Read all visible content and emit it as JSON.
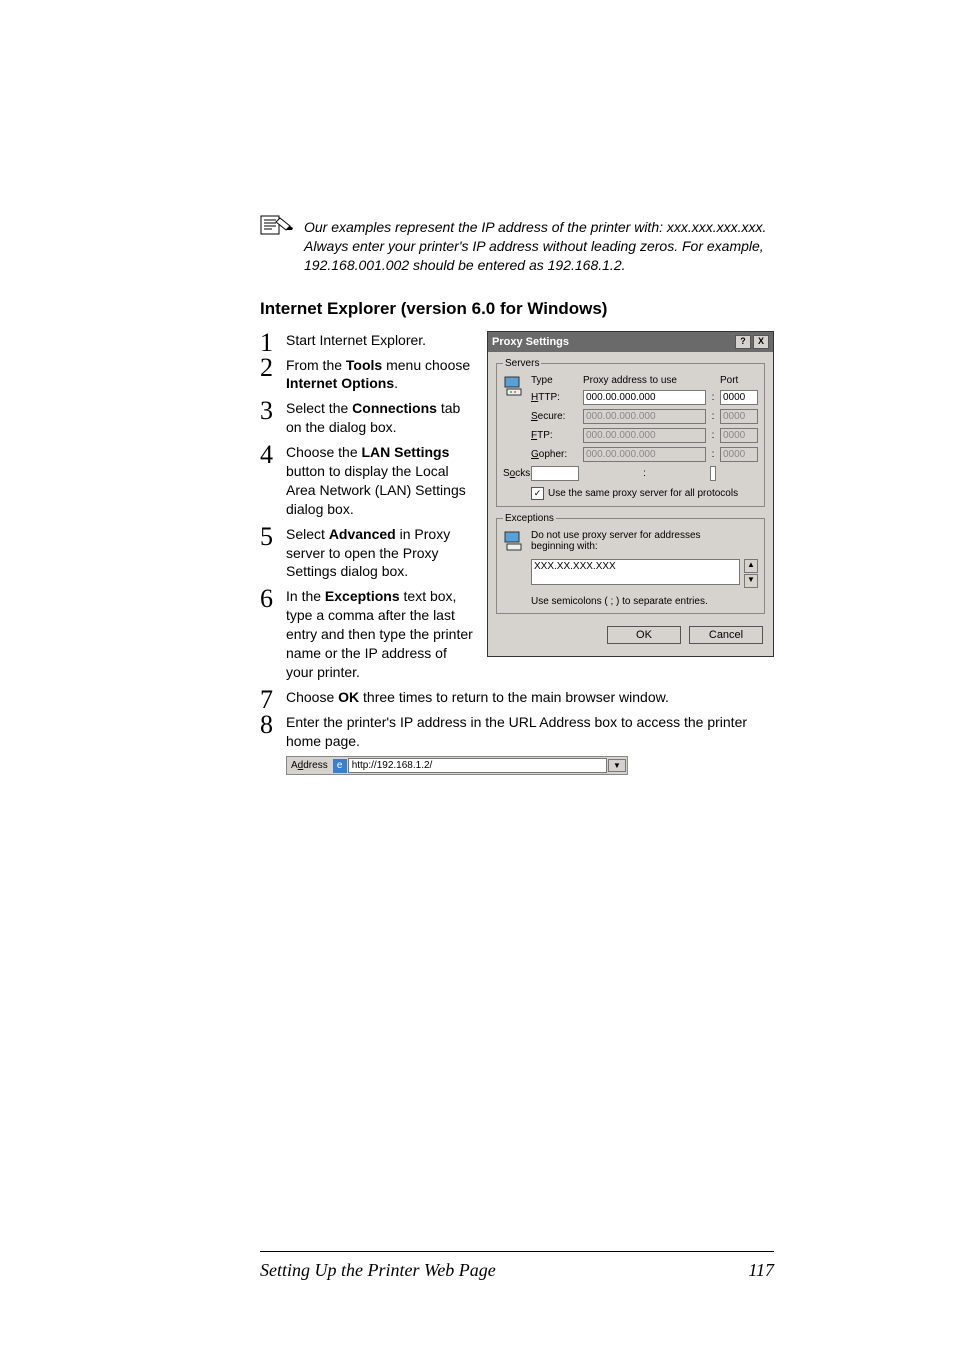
{
  "note": {
    "text": "Our examples represent the IP address of the printer with: xxx.xxx.xxx.xxx. Always enter your printer's IP address without leading zeros. For example, 192.168.001.002 should be entered as 192.168.1.2."
  },
  "section_heading": "Internet Explorer (version 6.0 for Windows)",
  "steps_top": {
    "s1": "Start Internet Explorer.",
    "s2a": "From the ",
    "s2b": "Tools",
    "s2c": " menu choose ",
    "s2d": "Internet Options",
    "s2e": ".",
    "s3a": "Select the ",
    "s3b": "Connections",
    "s3c": " tab on the dialog box.",
    "s4a": "Choose the ",
    "s4b": "LAN Settings",
    "s4c": " button to display the Local Area Network (LAN) Settings dialog box.",
    "s5a": "Select ",
    "s5b": "Advanced",
    "s5c": " in Proxy server to open the Proxy Settings dialog box.",
    "s6a": "In the ",
    "s6b": "Exceptions",
    "s6c": " text box, type a comma after the last entry and then type the printer name or the IP address of your printer."
  },
  "steps_bottom": {
    "s7a": "Choose ",
    "s7b": "OK",
    "s7c": " three times to return to the main browser window.",
    "s8": "Enter the printer's IP address in the URL Address box to access the printer home page."
  },
  "proxy": {
    "title": "Proxy Settings",
    "help": "?",
    "close": "X",
    "servers_legend": "Servers",
    "type_hdr": "Type",
    "addr_hdr": "Proxy address to use",
    "port_hdr": "Port",
    "http_lbl": "HTTP:",
    "secure_lbl": "Secure:",
    "ftp_lbl": "FTP:",
    "gopher_lbl": "Gopher:",
    "socks_lbl": "Socks:",
    "http_addr": "000.00.000.000",
    "secure_addr": "000.00.000.000",
    "ftp_addr": "000.00.000.000",
    "gopher_addr": "000.00.000.000",
    "socks_addr": "",
    "http_port": "0000",
    "secure_port": "0000",
    "ftp_port": "0000",
    "gopher_port": "0000",
    "socks_port": "",
    "same": "Use the same proxy server for all protocols",
    "exceptions_legend": "Exceptions",
    "ex_label": "Do not use proxy server for addresses beginning with:",
    "ex_value": "XXX.XX.XXX.XXX",
    "sep_note": "Use semicolons ( ; ) to separate entries.",
    "ok": "OK",
    "cancel": "Cancel"
  },
  "address_bar": {
    "label": "Address",
    "icon": "e",
    "url": "http://192.168.1.2/"
  },
  "footer": {
    "title": "Setting Up the Printer Web Page",
    "page": "117"
  }
}
